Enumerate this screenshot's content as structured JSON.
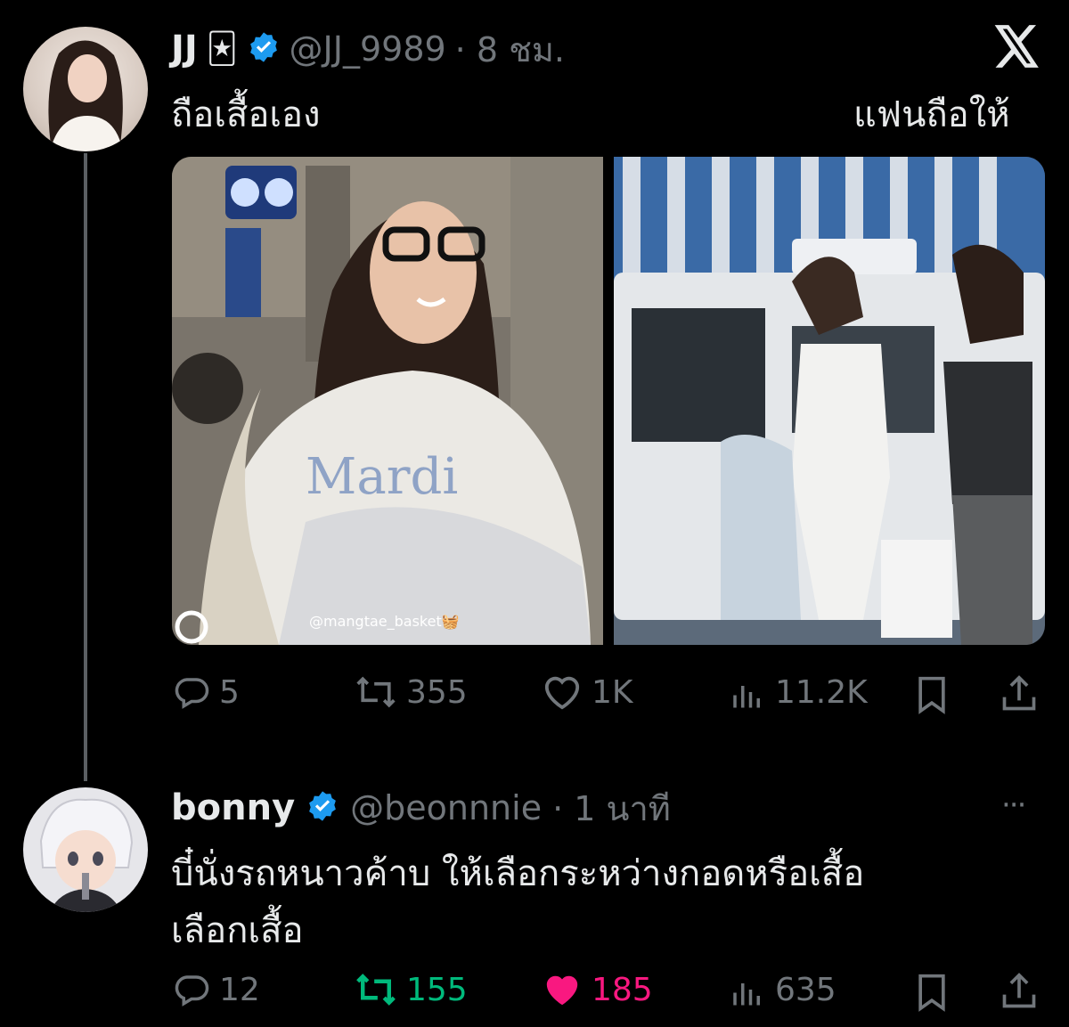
{
  "tweet1": {
    "name": "JJ",
    "name_emoji": "🃏",
    "handle": "@JJ_9989",
    "time": "· 8 ชม.",
    "text_left": "ถือเสื้อเอง",
    "text_right": "แฟนถือให้",
    "image_watermark": "@mangtae_basket🧺",
    "image_shirt_text": "Mardi",
    "stats": {
      "replies": "5",
      "retweets": "355",
      "likes": "1K",
      "views": "11.2K"
    }
  },
  "tweet2": {
    "name": "bonny",
    "handle": "@beonnnie",
    "time": "· 1 นาที",
    "text_line1": "บี๋นั่งรถหนาวค้าบ ให้เลือกระหว่างกอดหรือเสื้อ",
    "text_line2": "เลือกเสื้อ",
    "more": "···",
    "stats": {
      "replies": "12",
      "retweets": "155",
      "likes": "185",
      "views": "635"
    }
  },
  "colors": {
    "verified": "#1d9bf0",
    "retweet_active": "#00ba7c",
    "like_active": "#f91880",
    "muted": "#71767b"
  }
}
